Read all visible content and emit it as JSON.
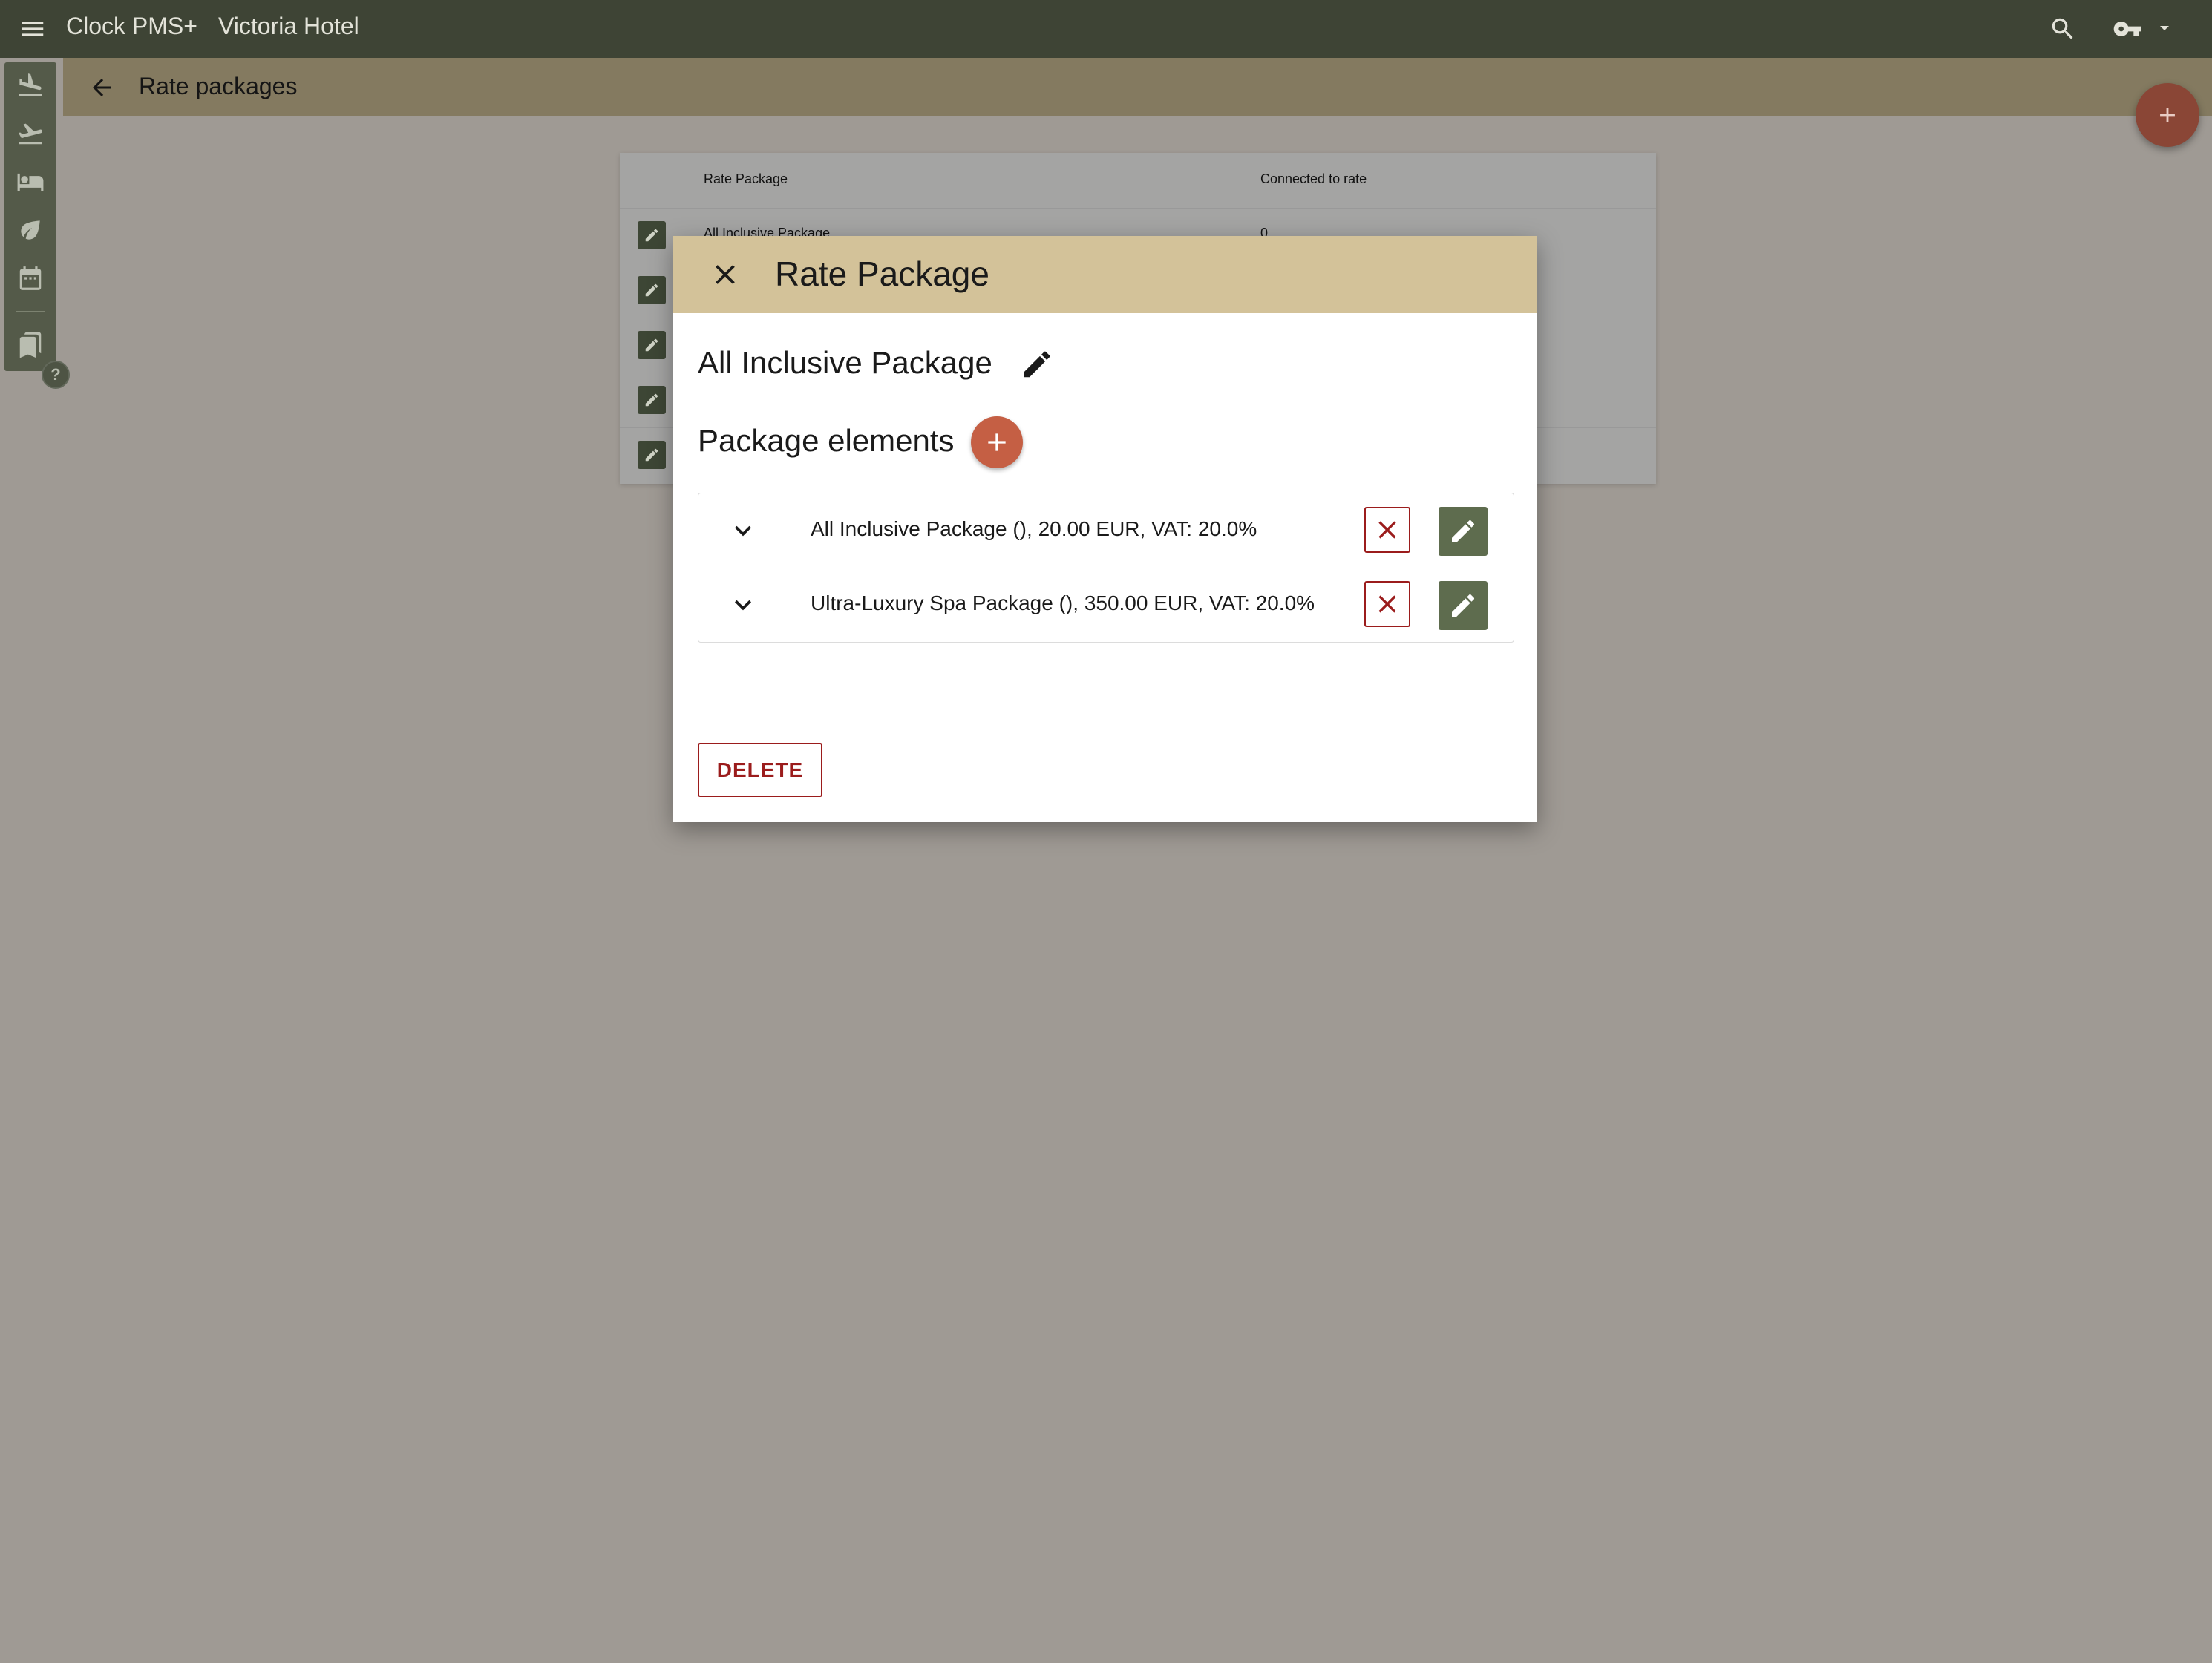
{
  "app": {
    "name": "Clock PMS+",
    "hotel": "Victoria Hotel"
  },
  "colors": {
    "topbar": "#3e4435",
    "subbar": "#847a60",
    "dialog_header": "#d3c299",
    "accent_add": "#c55f44",
    "danger": "#9b1c1c",
    "edit_button": "#5e6c4e"
  },
  "subheader": {
    "title": "Rate packages"
  },
  "rail": {
    "icons": [
      "arrivals-icon",
      "departures-icon",
      "rooms-icon",
      "housekeeping-icon",
      "calendar-icon",
      "bookmarks-icon"
    ],
    "help_label": "?"
  },
  "table": {
    "columns": [
      "Rate Package",
      "Connected to rate"
    ],
    "rows": [
      {
        "name": "All Inclusive Package",
        "connected": "0"
      },
      {
        "name": "",
        "connected": ""
      },
      {
        "name": "",
        "connected": ""
      },
      {
        "name": "",
        "connected": ""
      },
      {
        "name": "",
        "connected": ""
      }
    ]
  },
  "dialog": {
    "title": "Rate Package",
    "package_name": "All Inclusive Package",
    "elements_title": "Package elements",
    "elements": [
      {
        "label": "All Inclusive Package (), 20.00 EUR, VAT: 20.0%"
      },
      {
        "label": "Ultra-Luxury Spa Package (), 350.00 EUR, VAT: 20.0%"
      }
    ],
    "delete_label": "DELETE"
  }
}
